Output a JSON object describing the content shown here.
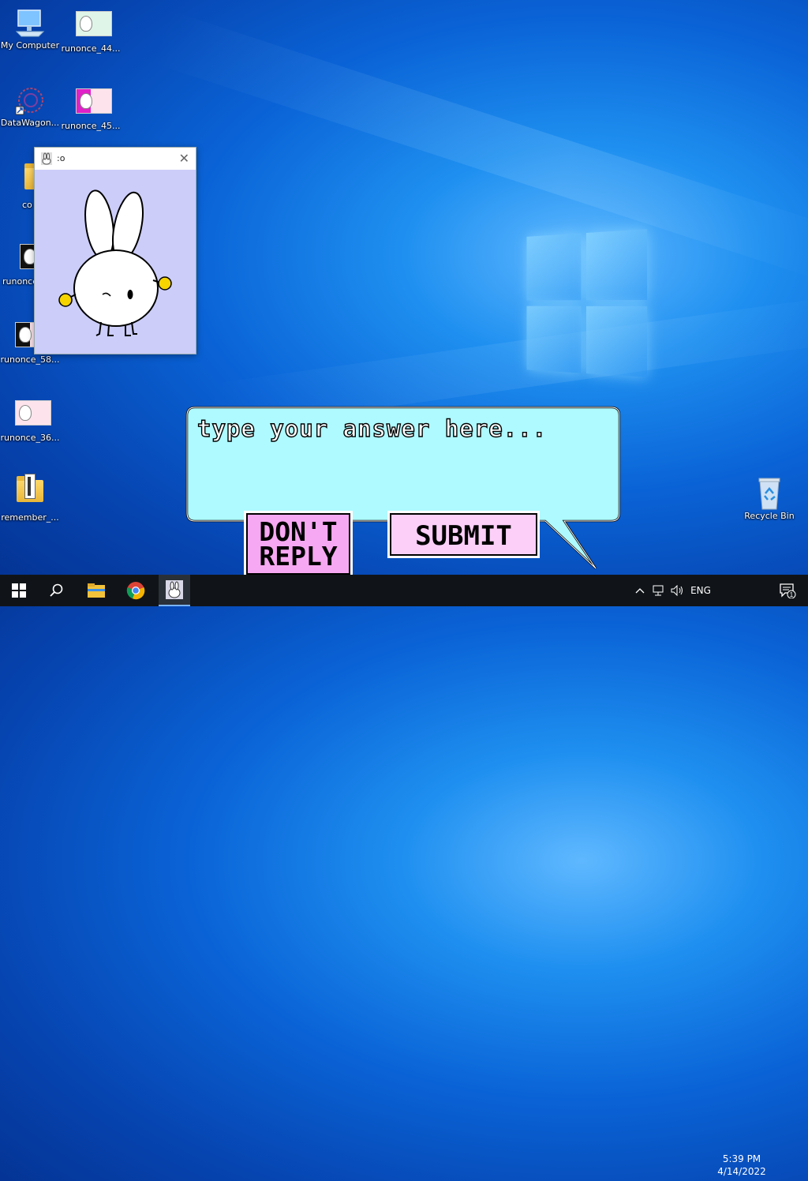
{
  "desktop": {
    "icons": [
      {
        "label": "My Computer"
      },
      {
        "label": "runonce_44..."
      },
      {
        "label": "DataWagon..."
      },
      {
        "label": "runonce_45..."
      },
      {
        "label": "co"
      },
      {
        "label": "runonce"
      },
      {
        "label": "runonce_58..."
      },
      {
        "label": "runonce_36..."
      },
      {
        "label": "remember_..."
      },
      {
        "label": "Recycle Bin"
      }
    ]
  },
  "popup_window": {
    "title": ":o"
  },
  "speech_bubble": {
    "placeholder": "type your answer here...",
    "dont_reply_line1": "DON'T",
    "dont_reply_line2": "REPLY",
    "submit_label": "SUBMIT"
  },
  "taskbar": {
    "language": "ENG",
    "time": "5:39 PM",
    "date": "4/14/2022",
    "notification_count": "1"
  }
}
